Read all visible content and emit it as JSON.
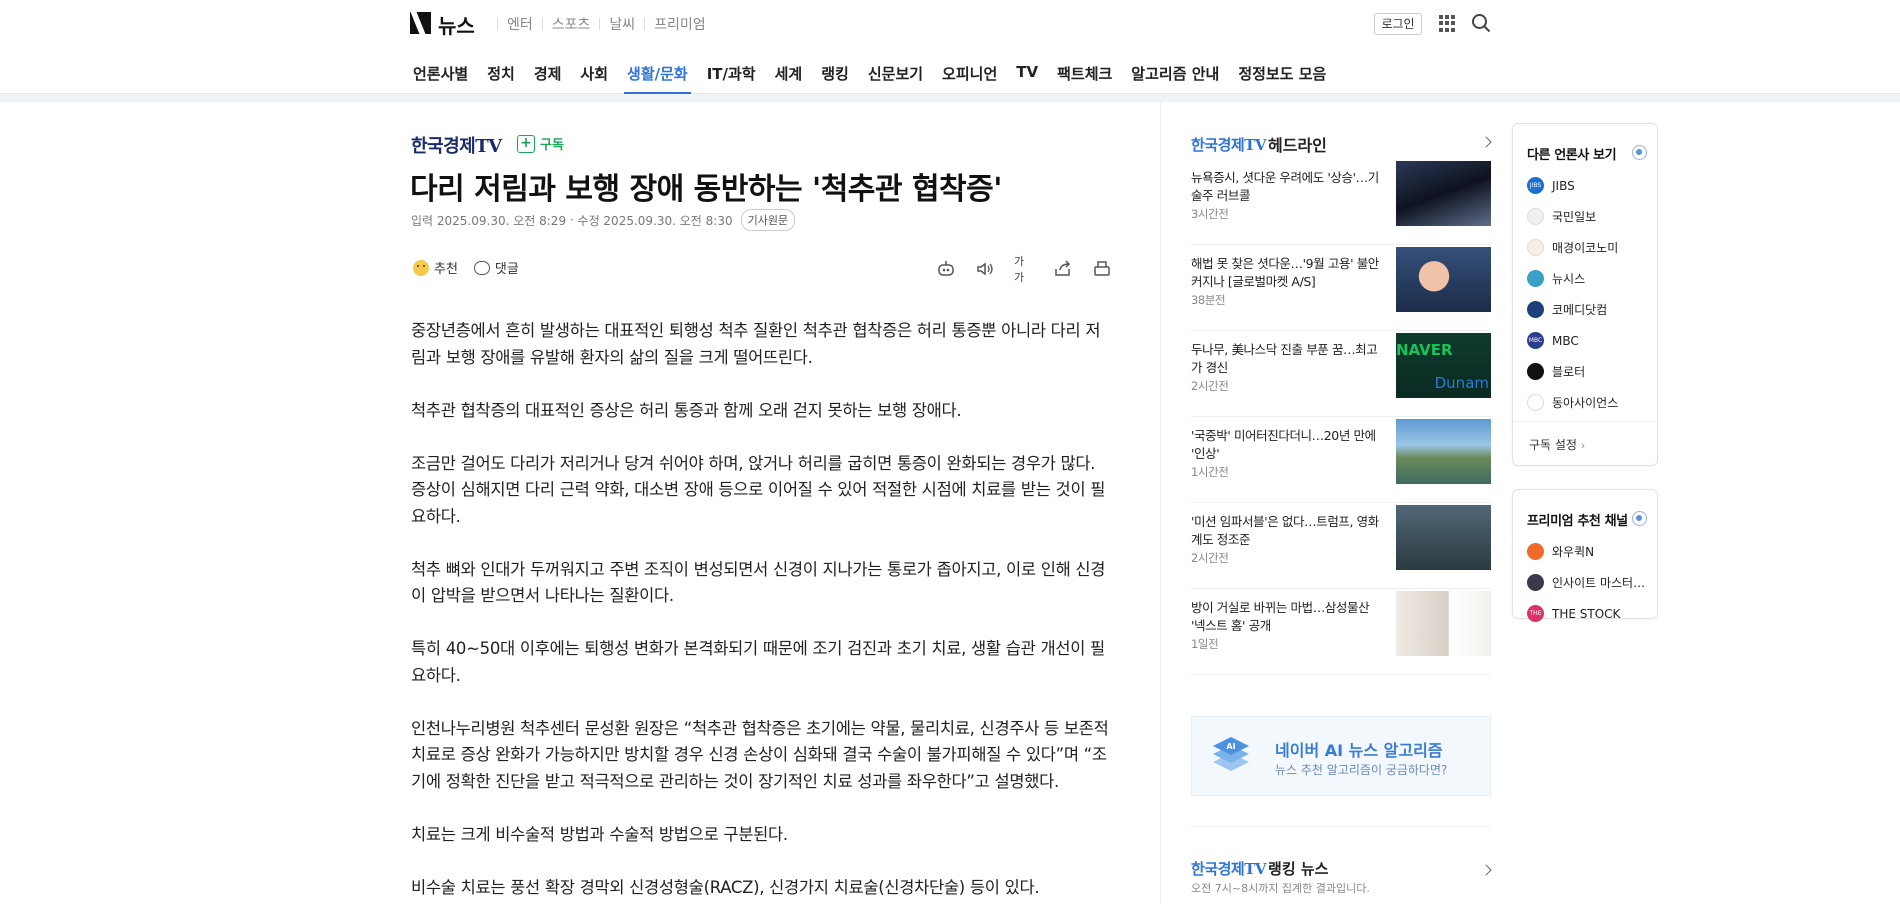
{
  "header": {
    "brand": "뉴스",
    "services": [
      "엔터",
      "스포츠",
      "날씨",
      "프리미엄"
    ],
    "login_label": "로그인"
  },
  "nav": {
    "items": [
      "언론사별",
      "정치",
      "경제",
      "사회",
      "생활/문화",
      "IT/과학",
      "세계",
      "랭킹",
      "신문보기",
      "오피니언",
      "TV",
      "팩트체크",
      "알고리즘 안내",
      "정정보도 모음"
    ],
    "active_index": 4,
    "accent_color": "#2e74d8"
  },
  "article": {
    "press": "한국경제TV",
    "subscribe_label": "구독",
    "headline": "다리 저림과 보행 장애 동반하는 '척추관 협착증'",
    "input_date": "입력 2025.09.30. 오전 8:29",
    "modified_date": "수정 2025.09.30. 오전 8:30",
    "original_label": "기사원문",
    "recommend_label": "추천",
    "comment_label": "댓글",
    "tool_icons": [
      "summary-robot-icon",
      "speaker-icon",
      "font-size-icon",
      "share-icon",
      "print-icon"
    ],
    "font_size_glyph": "가가",
    "paragraphs": [
      "중장년층에서 흔히 발생하는 대표적인 퇴행성 척추 질환인 척추관 협착증은 허리 통증뿐 아니라 다리 저림과 보행 장애를 유발해 환자의 삶의 질을 크게 떨어뜨린다.",
      "척추관 협착증의 대표적인 증상은 허리 통증과 함께 오래 걷지 못하는 보행 장애다.",
      "조금만 걸어도 다리가 저리거나 당겨 쉬어야 하며, 앉거나 허리를 굽히면 통증이 완화되는 경우가 많다. 증상이 심해지면 다리 근력 약화, 대소변 장애 등으로 이어질 수 있어 적절한 시점에 치료를 받는 것이 필요하다.",
      "척추 뼈와 인대가 두꺼워지고 주변 조직이 변성되면서 신경이 지나가는 통로가 좁아지고, 이로 인해 신경이 압박을 받으면서 나타나는 질환이다.",
      "특히 40~50대 이후에는 퇴행성 변화가 본격화되기 때문에 조기 검진과 초기 치료, 생활 습관 개선이 필요하다.",
      "인천나누리병원 척추센터 문성환 원장은 “척추관 협착증은 초기에는 약물, 물리치료, 신경주사 등 보존적 치료로 증상 완화가 가능하지만 방치할 경우 신경 손상이 심화돼 결국 수술이 불가피해질 수 있다”며 “조기에 정확한 진단을 받고 적극적으로 관리하는 것이 장기적인 치료 성과를 좌우한다”고 설명했다.",
      "치료는 크게 비수술적 방법과 수술적 방법으로 구분된다.",
      "비수술 치료는 풍선 확장 경막외 신경성형술(RACZ), 신경가지 치료술(신경차단술) 등이 있다."
    ]
  },
  "headlines": {
    "press": "한국경제TV",
    "title_suffix": "헤드라인",
    "items": [
      {
        "title": "뉴욕증시, 셧다운 우려에도 '상승'…기술주 러브콜",
        "ago": "3시간전"
      },
      {
        "title": "해법 못 찾은 셧다운…'9월 고용' 불안 커지나 [글로벌마켓 A/S]",
        "ago": "38분전"
      },
      {
        "title": "두나무, 美나스닥 진출 부푼 꿈…최고가 경신",
        "ago": "2시간전"
      },
      {
        "title": "'국중박' 미어터진다더니…20년 만에 '인상'",
        "ago": "1시간전"
      },
      {
        "title": "'미션 임파서블'은 없다…트럼프, 영화계도 정조준",
        "ago": "2시간전"
      },
      {
        "title": "방이 거실로 바뀌는 마법…삼성물산 '넥스트 홈' 공개",
        "ago": "1일전"
      }
    ],
    "thumb3_text1": "NAVER",
    "thumb3_text2": "Dunam"
  },
  "ai_banner": {
    "title": "네이버 AI 뉴스 알고리즘",
    "subtitle": "뉴스 추천 알고리즘이 궁금하다면?",
    "icon_text": "AI"
  },
  "ranking": {
    "press": "한국경제TV",
    "title_suffix": "랭킹 뉴스",
    "subtitle": "오전 7시~8시까지 집계한 결과입니다."
  },
  "other_press": {
    "title": "다른 언론사 보기",
    "items": [
      {
        "name": "JIBS",
        "color": "#1a6fd0",
        "mark": "JIBS"
      },
      {
        "name": "국민일보",
        "color": "#f0f0f0",
        "mark": ""
      },
      {
        "name": "매경이코노미",
        "color": "#f6efe8",
        "mark": ""
      },
      {
        "name": "뉴시스",
        "color": "#3aa0c8",
        "mark": ""
      },
      {
        "name": "코메디닷컴",
        "color": "#1e3f7a",
        "mark": ""
      },
      {
        "name": "MBC",
        "color": "#2c3e8c",
        "mark": "MBC"
      },
      {
        "name": "블로터",
        "color": "#111111",
        "mark": ""
      },
      {
        "name": "동아사이언스",
        "color": "#ffffff",
        "mark": ""
      }
    ],
    "setting_label": "구독 설정"
  },
  "premium": {
    "title": "프리미엄 추천 채널",
    "items": [
      {
        "name": "와우퀵N",
        "color": "#f06a2a",
        "mark": ""
      },
      {
        "name": "인사이트 마스터…",
        "color": "#3a3a4a",
        "mark": ""
      },
      {
        "name": "THE STOCK",
        "color": "#e0306a",
        "mark": "THE"
      }
    ]
  }
}
